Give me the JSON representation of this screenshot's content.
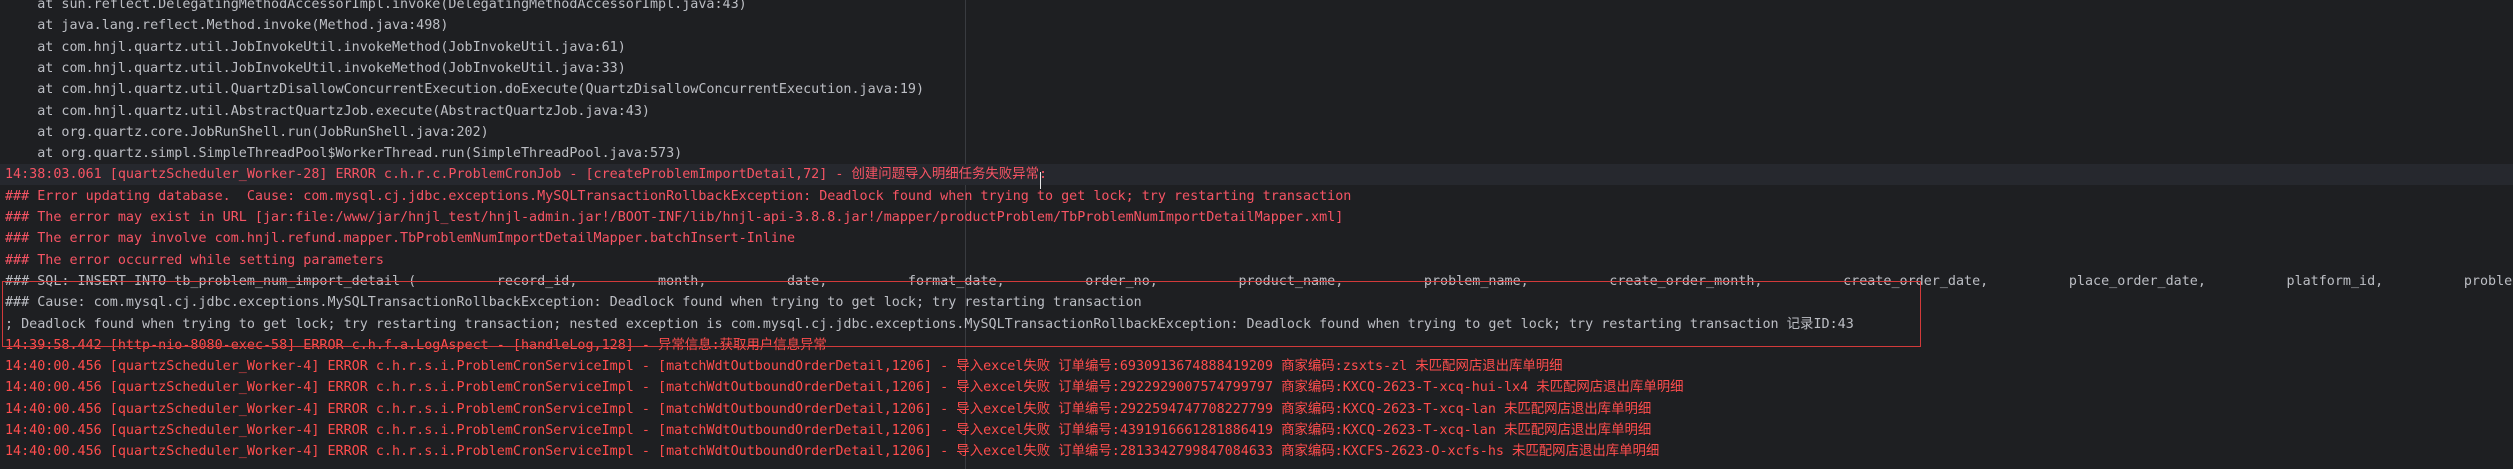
{
  "console": {
    "lines": [
      {
        "text": "    at sun.reflect.DelegatingMethodAccessorImpl.invoke(DelegatingMethodAccessorImpl.java:43)",
        "kind": "normal"
      },
      {
        "text": "    at java.lang.reflect.Method.invoke(Method.java:498)",
        "kind": "normal"
      },
      {
        "text": "    at com.hnjl.quartz.util.JobInvokeUtil.invokeMethod(JobInvokeUtil.java:61)",
        "kind": "normal"
      },
      {
        "text": "    at com.hnjl.quartz.util.JobInvokeUtil.invokeMethod(JobInvokeUtil.java:33)",
        "kind": "normal"
      },
      {
        "text": "    at com.hnjl.quartz.util.QuartzDisallowConcurrentExecution.doExecute(QuartzDisallowConcurrentExecution.java:19)",
        "kind": "normal"
      },
      {
        "text": "    at com.hnjl.quartz.util.AbstractQuartzJob.execute(AbstractQuartzJob.java:43)",
        "kind": "normal"
      },
      {
        "text": "    at org.quartz.core.JobRunShell.run(JobRunShell.java:202)",
        "kind": "normal"
      },
      {
        "text": "    at org.quartz.simpl.SimpleThreadPool$WorkerThread.run(SimpleThreadPool.java:573)",
        "kind": "normal"
      },
      {
        "text": "14:38:03.061 [quartzScheduler_Worker-28] ERROR c.h.r.c.ProblemCronJob - [createProblemImportDetail,72] - 创建问题导入明细任务失败异常:",
        "kind": "error"
      },
      {
        "text": "### Error updating database.  Cause: com.mysql.cj.jdbc.exceptions.MySQLTransactionRollbackException: Deadlock found when trying to get lock; try restarting transaction",
        "kind": "error"
      },
      {
        "text": "### The error may exist in URL [jar:file:/www/jar/hnjl_test/hnjl-admin.jar!/BOOT-INF/lib/hnjl-api-3.8.8.jar!/mapper/productProblem/TbProblemNumImportDetailMapper.xml]",
        "kind": "error"
      },
      {
        "text": "### The error may involve com.hnjl.refund.mapper.TbProblemNumImportDetailMapper.batchInsert-Inline",
        "kind": "error"
      },
      {
        "text": "### The error occurred while setting parameters",
        "kind": "error"
      },
      {
        "text": "### SQL: INSERT INTO tb_problem_num_import_detail (          record_id,          month,          date,          format_date,          order_no,          product_name,          problem_name,          create_order_month,          create_order_date,          place_order_date,          platform_id,          problem_type,",
        "kind": "normal"
      },
      {
        "text": "### Cause: com.mysql.cj.jdbc.exceptions.MySQLTransactionRollbackException: Deadlock found when trying to get lock; try restarting transaction",
        "kind": "normal"
      },
      {
        "text": "; Deadlock found when trying to get lock; try restarting transaction; nested exception is com.mysql.cj.jdbc.exceptions.MySQLTransactionRollbackException: Deadlock found when trying to get lock; try restarting transaction 记录ID:43",
        "kind": "normal"
      },
      {
        "text": "14:39:58.442 [http-nio-8080-exec-58] ERROR c.h.f.a.LogAspect - [handleLog,128] - 异常信息:获取用户信息异常",
        "kind": "error-bright"
      },
      {
        "text": "14:40:00.456 [quartzScheduler_Worker-4] ERROR c.h.r.s.i.ProblemCronServiceImpl - [matchWdtOutboundOrderDetail,1206] - 导入excel失败 订单编号:6930913674888419209 商家编码:zsxts-zl 未匹配网店退出库单明细",
        "kind": "error-bright"
      },
      {
        "text": "14:40:00.456 [quartzScheduler_Worker-4] ERROR c.h.r.s.i.ProblemCronServiceImpl - [matchWdtOutboundOrderDetail,1206] - 导入excel失败 订单编号:2922929007574799797 商家编码:KXCQ-2623-T-xcq-hui-lx4 未匹配网店退出库单明细",
        "kind": "error-bright"
      },
      {
        "text": "14:40:00.456 [quartzScheduler_Worker-4] ERROR c.h.r.s.i.ProblemCronServiceImpl - [matchWdtOutboundOrderDetail,1206] - 导入excel失败 订单编号:2922594747708227799 商家编码:KXCQ-2623-T-xcq-lan 未匹配网店退出库单明细",
        "kind": "error-bright"
      },
      {
        "text": "14:40:00.456 [quartzScheduler_Worker-4] ERROR c.h.r.s.i.ProblemCronServiceImpl - [matchWdtOutboundOrderDetail,1206] - 导入excel失败 订单编号:4391916661281886419 商家编码:KXCQ-2623-T-xcq-lan 未匹配网店退出库单明细",
        "kind": "error-bright"
      },
      {
        "text": "14:40:00.456 [quartzScheduler_Worker-4] ERROR c.h.r.s.i.ProblemCronServiceImpl - [matchWdtOutboundOrderDetail,1206] - 导入excel失败 订单编号:2813342799847084633 商家编码:KXCFS-2623-O-xcfs-hs 未匹配网店退出库单明细",
        "kind": "error-bright"
      }
    ]
  },
  "colors": {
    "background": "#1e1f22",
    "normal_text": "#bcbec4",
    "error_text": "#f75464",
    "selection_border": "#d23a3a"
  }
}
